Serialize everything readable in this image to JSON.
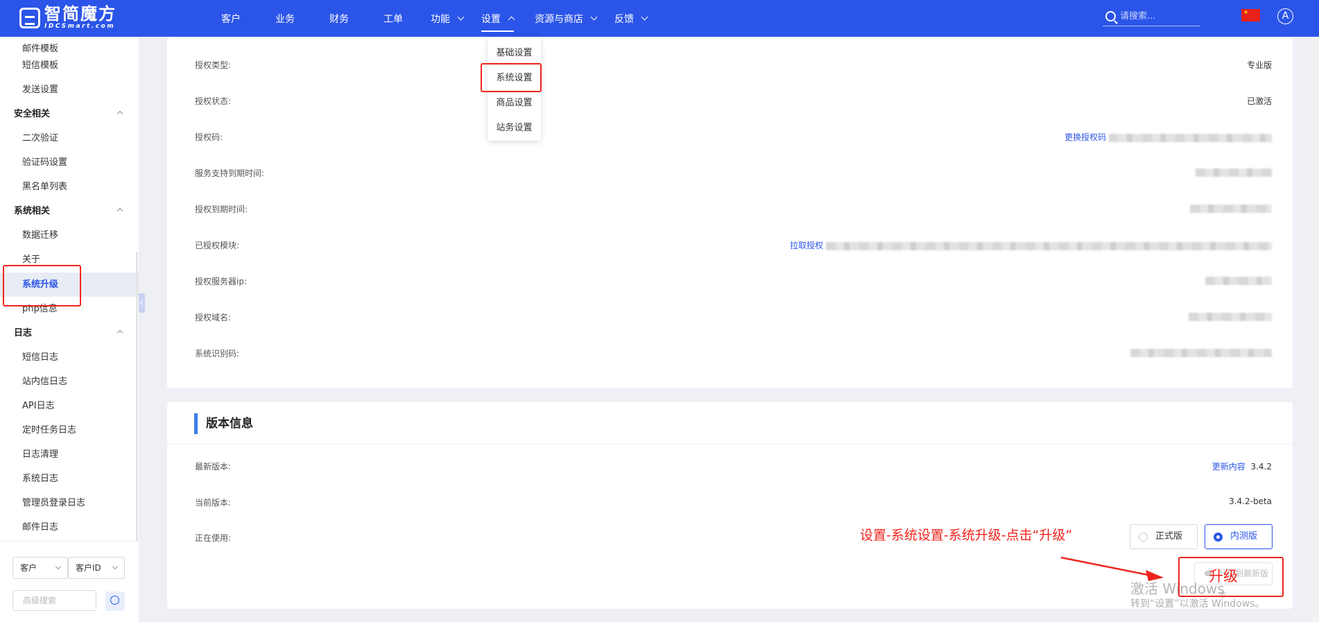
{
  "brand": {
    "name_cn": "智简魔方",
    "name_en": "IDCSmart.com"
  },
  "nav": [
    {
      "label": "客户",
      "dropdown": false
    },
    {
      "label": "业务",
      "dropdown": false
    },
    {
      "label": "财务",
      "dropdown": false
    },
    {
      "label": "工单",
      "dropdown": false
    },
    {
      "label": "功能",
      "dropdown": true
    },
    {
      "label": "设置",
      "dropdown": true,
      "active": true
    },
    {
      "label": "资源与商店",
      "dropdown": true
    },
    {
      "label": "反馈",
      "dropdown": true
    }
  ],
  "search": {
    "placeholder": "请搜索..."
  },
  "avatar": {
    "initial": "A"
  },
  "settings_menu": [
    "基础设置",
    "系统设置",
    "商品设置",
    "站务设置"
  ],
  "sidebar": {
    "items": [
      {
        "label": "邮件模板",
        "type": "item"
      },
      {
        "label": "短信模板",
        "type": "item"
      },
      {
        "label": "发送设置",
        "type": "item"
      },
      {
        "label": "安全相关",
        "type": "group"
      },
      {
        "label": "二次验证",
        "type": "item"
      },
      {
        "label": "验证码设置",
        "type": "item"
      },
      {
        "label": "黑名单列表",
        "type": "item"
      },
      {
        "label": "系统相关",
        "type": "group"
      },
      {
        "label": "数据迁移",
        "type": "item"
      },
      {
        "label": "关于",
        "type": "item"
      },
      {
        "label": "系统升级",
        "type": "item",
        "active": true
      },
      {
        "label": "php信息",
        "type": "item"
      },
      {
        "label": "日志",
        "type": "group"
      },
      {
        "label": "短信日志",
        "type": "item"
      },
      {
        "label": "站内信日志",
        "type": "item"
      },
      {
        "label": "API日志",
        "type": "item"
      },
      {
        "label": "定时任务日志",
        "type": "item"
      },
      {
        "label": "日志清理",
        "type": "item"
      },
      {
        "label": "系统日志",
        "type": "item"
      },
      {
        "label": "管理员登录日志",
        "type": "item"
      },
      {
        "label": "邮件日志",
        "type": "item"
      }
    ],
    "filter_select_1": "客户",
    "filter_select_2": "客户ID",
    "advanced_search_placeholder": "高级搜索"
  },
  "license": {
    "rows": [
      {
        "label": "授权类型:",
        "value": "专业版"
      },
      {
        "label": "授权状态:",
        "value": "已激活"
      },
      {
        "label": "授权码:",
        "link": "更换授权码"
      },
      {
        "label": "服务支持到期时间:"
      },
      {
        "label": "授权到期时间:"
      },
      {
        "label": "已授权模块:",
        "link": "拉取授权"
      },
      {
        "label": "授权服务器ip:"
      },
      {
        "label": "授权域名:"
      },
      {
        "label": "系统识别码:"
      }
    ]
  },
  "version": {
    "title": "版本信息",
    "latest_label": "最新版本:",
    "latest_link": "更新内容",
    "latest_value": "3.4.2",
    "current_label": "当前版本:",
    "current_value": "3.4.2-beta",
    "using_label": "正在使用:",
    "channels": [
      "正式版",
      "内测版"
    ],
    "selected_channel": "内测版",
    "upgrade_button": "升级到最新版本"
  },
  "annotation": {
    "instruction": "设置-系统设置-系统升级-点击“升级”",
    "upgrade_label": "升级",
    "color": "#f0241c"
  },
  "watermark": {
    "line1": "激活 Windows",
    "line2": "转到“设置”以激活 Windows。"
  },
  "colors": {
    "primary": "#2b55e8",
    "accent_bar": "#3b7de6"
  }
}
